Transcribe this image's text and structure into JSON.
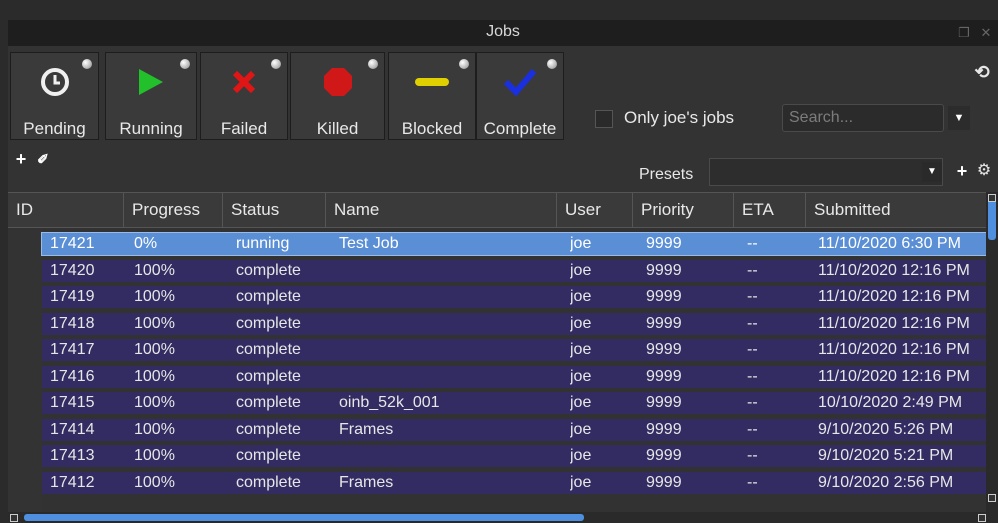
{
  "window": {
    "title": "Jobs"
  },
  "filters": [
    {
      "label": "Pending",
      "icon": "clock-icon"
    },
    {
      "label": "Running",
      "icon": "play-icon",
      "color": "#22c02a"
    },
    {
      "label": "Failed",
      "icon": "x-icon",
      "color": "#e01515"
    },
    {
      "label": "Killed",
      "icon": "stop-octagon-icon",
      "color": "#d01818"
    },
    {
      "label": "Blocked",
      "icon": "dash-icon",
      "color": "#e0d000"
    },
    {
      "label": "Complete",
      "icon": "checkmark-icon",
      "color": "#1a2fe0"
    }
  ],
  "only_jobs": {
    "label": "Only joe's jobs",
    "checked": false
  },
  "search": {
    "placeholder": "Search..."
  },
  "presets": {
    "label": "Presets",
    "value": ""
  },
  "table": {
    "columns": [
      "ID",
      "Progress",
      "Status",
      "Name",
      "User",
      "Priority",
      "ETA",
      "Submitted"
    ],
    "rows": [
      [
        "17421",
        "0%",
        "running",
        "Test Job",
        "joe",
        "9999",
        "--",
        "11/10/2020 6:30 PM"
      ],
      [
        "17420",
        "100%",
        "complete",
        "",
        "joe",
        "9999",
        "--",
        "11/10/2020 12:16 PM"
      ],
      [
        "17419",
        "100%",
        "complete",
        "",
        "joe",
        "9999",
        "--",
        "11/10/2020 12:16 PM"
      ],
      [
        "17418",
        "100%",
        "complete",
        "",
        "joe",
        "9999",
        "--",
        "11/10/2020 12:16 PM"
      ],
      [
        "17417",
        "100%",
        "complete",
        "",
        "joe",
        "9999",
        "--",
        "11/10/2020 12:16 PM"
      ],
      [
        "17416",
        "100%",
        "complete",
        "",
        "joe",
        "9999",
        "--",
        "11/10/2020 12:16 PM"
      ],
      [
        "17415",
        "100%",
        "complete",
        "oinb_52k_001",
        "joe",
        "9999",
        "--",
        "10/10/2020 2:49 PM"
      ],
      [
        "17414",
        "100%",
        "complete",
        "Frames",
        "joe",
        "9999",
        "--",
        "9/10/2020 5:26 PM"
      ],
      [
        "17413",
        "100%",
        "complete",
        "",
        "joe",
        "9999",
        "--",
        "9/10/2020 5:21 PM"
      ],
      [
        "17412",
        "100%",
        "complete",
        "Frames",
        "joe",
        "9999",
        "--",
        "9/10/2020 2:56 PM"
      ]
    ],
    "selected_row": 0
  },
  "colors": {
    "selection": "#5a8fd6",
    "row_bg": "#322c63",
    "scrollbar": "#4f8fe0"
  }
}
